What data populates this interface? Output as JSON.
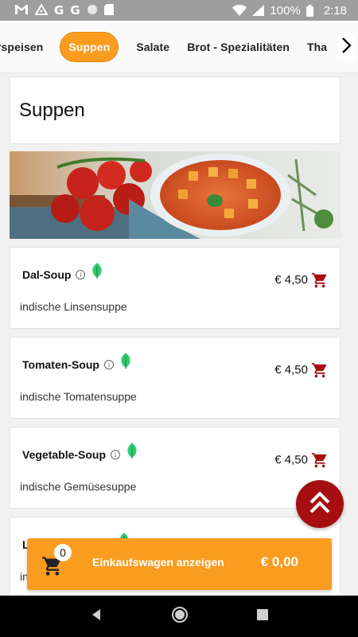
{
  "status_bar": {
    "icons": [
      "gmail-icon",
      "alert-icon",
      "google-icon",
      "google-icon",
      "circle-icon",
      "sdcard-icon"
    ],
    "battery": "100%",
    "time": "2:18"
  },
  "tabs": {
    "items": [
      "Vorspeisen",
      "Suppen",
      "Salate",
      "Brot - Spezialitäten",
      "Thali"
    ],
    "first_visible": "rspeisen",
    "last_visible": "Tha",
    "active": "Suppen"
  },
  "section": {
    "title": "Suppen"
  },
  "items": [
    {
      "name": "Dal-Soup",
      "description": "indische Linsensuppe",
      "price": "€ 4,50",
      "vegan": true
    },
    {
      "name": "Tomaten-Soup",
      "description": "indische Tomatensuppe",
      "price": "€ 4,50",
      "vegan": true
    },
    {
      "name": "Vegetable-Soup",
      "description": "indische Gemüsesuppe",
      "price": "€ 4,50",
      "vegan": true
    }
  ],
  "cart": {
    "count": "0",
    "label": "Einkaufswagen anzeigen",
    "total": "€ 0,00"
  },
  "colors": {
    "accent": "#f99c20",
    "dark_red": "#a50f11",
    "leaf_green": "#2ecc71"
  }
}
